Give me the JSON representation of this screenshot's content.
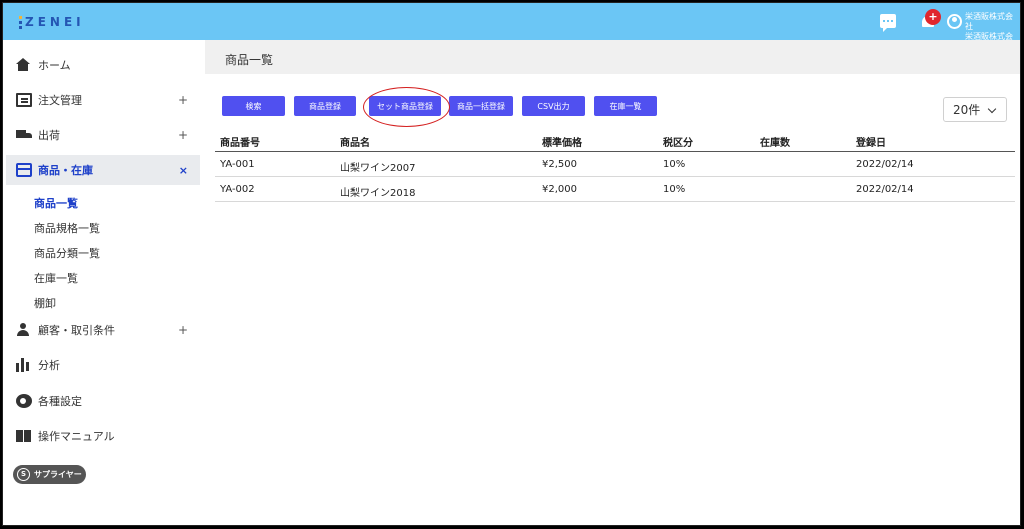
{
  "header": {
    "logo": "ZENEI",
    "notification_count": "+",
    "user_line1": "栄酒販株式会社",
    "user_line2": "栄酒販株式会社"
  },
  "sidebar": {
    "items": [
      {
        "label": "ホーム",
        "icon": "home-icon"
      },
      {
        "label": "注文管理",
        "icon": "order-icon",
        "expander": "+"
      },
      {
        "label": "出荷",
        "icon": "truck-icon",
        "expander": "+"
      },
      {
        "label": "商品・在庫",
        "icon": "box-icon",
        "expander": "×"
      },
      {
        "label": "顧客・取引条件",
        "icon": "person-icon",
        "expander": "+"
      },
      {
        "label": "分析",
        "icon": "chart-icon"
      },
      {
        "label": "各種設定",
        "icon": "gear-icon"
      },
      {
        "label": "操作マニュアル",
        "icon": "book-icon"
      }
    ],
    "subitems": [
      "商品一覧",
      "商品規格一覧",
      "商品分類一覧",
      "在庫一覧",
      "棚卸"
    ],
    "supplier_label": "サプライヤー",
    "supplier_icon_letter": "S"
  },
  "main": {
    "title": "商品一覧",
    "buttons": [
      "検索",
      "商品登録",
      "セット商品登録",
      "商品一括登録",
      "CSV出力",
      "在庫一覧"
    ],
    "per_page": "20件",
    "table": {
      "headers": [
        "商品番号",
        "商品名",
        "標準価格",
        "税区分",
        "在庫数",
        "登録日"
      ],
      "rows": [
        [
          "YA-001",
          "山梨ワイン2007",
          "¥2,500",
          "10%",
          "",
          "2022/02/14"
        ],
        [
          "YA-002",
          "山梨ワイン2018",
          "¥2,000",
          "10%",
          "",
          "2022/02/14"
        ]
      ]
    }
  }
}
